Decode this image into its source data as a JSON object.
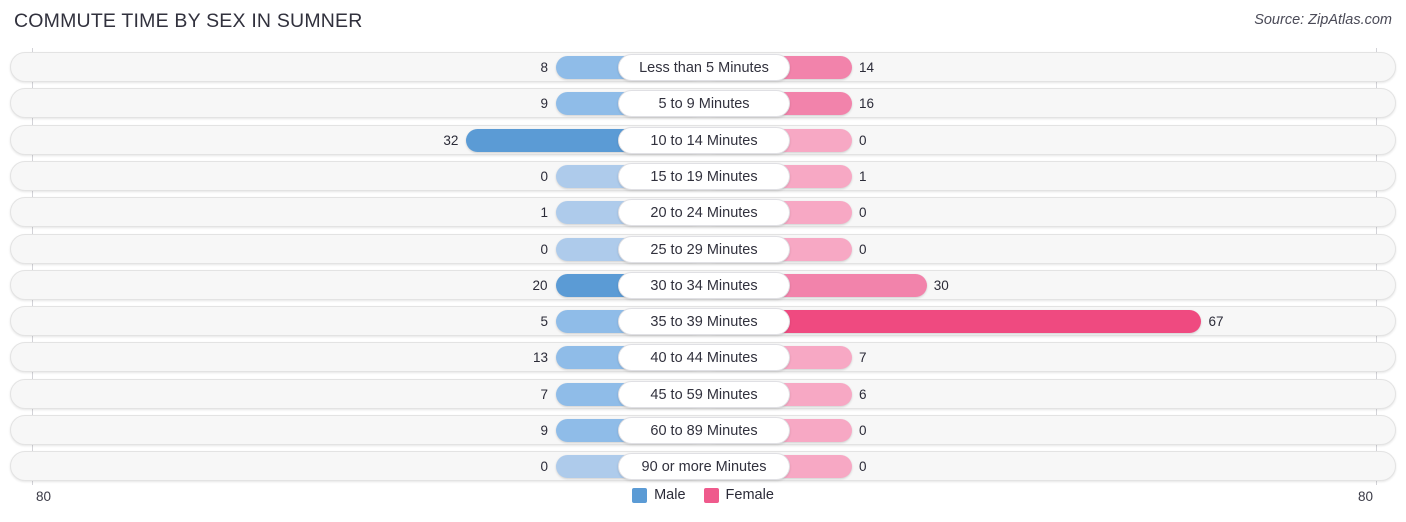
{
  "header": {
    "title": "COMMUTE TIME BY SEX IN SUMNER",
    "source": "Source: ZipAtlas.com"
  },
  "legend": {
    "items": [
      {
        "label": "Male",
        "color": "#5b9bd5"
      },
      {
        "label": "Female",
        "color": "#ef5a8c"
      }
    ]
  },
  "axis": {
    "left_tick": "80",
    "right_tick": "80"
  },
  "colors": {
    "male_strong": "#5b9bd5",
    "male_mid": "#8fbce8",
    "male_light": "#aecbeb",
    "female_strong": "#ef4a80",
    "female_mid": "#f283ab",
    "female_light": "#f7a8c4",
    "track": "#f7f7f7",
    "track_border": "#e3e3e3",
    "axis": "#d3d3d8"
  },
  "chart_data": {
    "type": "bar",
    "title": "COMMUTE TIME BY SEX IN SUMNER",
    "subtitle": "",
    "orientation": "horizontal-diverging",
    "xlabel": "",
    "ylabel": "",
    "xlim": [
      80,
      80
    ],
    "axis_left_max": 80,
    "axis_right_max": 80,
    "grid": false,
    "legend_position": "bottom-center",
    "categories": [
      "Less than 5 Minutes",
      "5 to 9 Minutes",
      "10 to 14 Minutes",
      "15 to 19 Minutes",
      "20 to 24 Minutes",
      "25 to 29 Minutes",
      "30 to 34 Minutes",
      "35 to 39 Minutes",
      "40 to 44 Minutes",
      "45 to 59 Minutes",
      "60 to 89 Minutes",
      "90 or more Minutes"
    ],
    "series": [
      {
        "name": "Male",
        "color": "#5b9bd5",
        "values": [
          8,
          9,
          32,
          0,
          1,
          0,
          20,
          5,
          13,
          7,
          9,
          0
        ]
      },
      {
        "name": "Female",
        "color": "#ef4a80",
        "values": [
          14,
          16,
          0,
          1,
          0,
          0,
          30,
          67,
          7,
          6,
          0,
          0
        ]
      }
    ]
  },
  "rows": [
    {
      "category": "Less than 5 Minutes",
      "male": "8",
      "female": "14"
    },
    {
      "category": "5 to 9 Minutes",
      "male": "9",
      "female": "16"
    },
    {
      "category": "10 to 14 Minutes",
      "male": "32",
      "female": "0"
    },
    {
      "category": "15 to 19 Minutes",
      "male": "0",
      "female": "1"
    },
    {
      "category": "20 to 24 Minutes",
      "male": "1",
      "female": "0"
    },
    {
      "category": "25 to 29 Minutes",
      "male": "0",
      "female": "0"
    },
    {
      "category": "30 to 34 Minutes",
      "male": "20",
      "female": "30"
    },
    {
      "category": "35 to 39 Minutes",
      "male": "5",
      "female": "67"
    },
    {
      "category": "40 to 44 Minutes",
      "male": "13",
      "female": "7"
    },
    {
      "category": "45 to 59 Minutes",
      "male": "7",
      "female": "6"
    },
    {
      "category": "60 to 89 Minutes",
      "male": "9",
      "female": "0"
    },
    {
      "category": "90 or more Minutes",
      "male": "0",
      "female": "0"
    }
  ]
}
